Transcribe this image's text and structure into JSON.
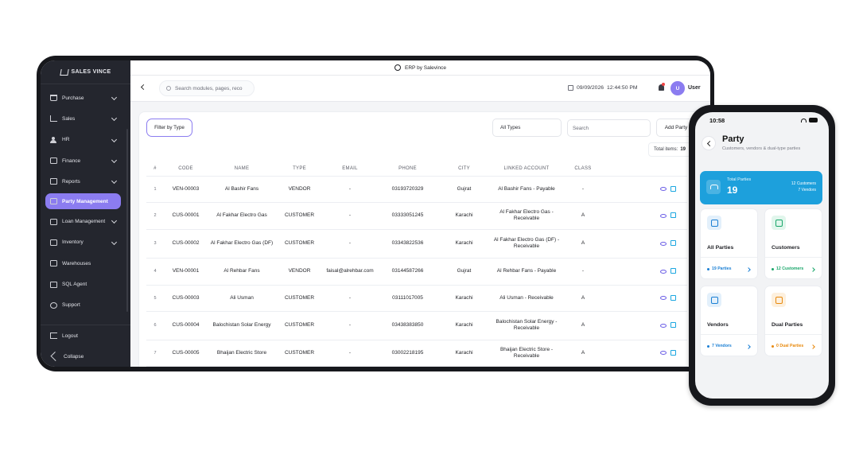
{
  "tablet": {
    "app_title": "ERP by Salevince",
    "brand": "SALES VINCE",
    "sidebar": {
      "items": [
        {
          "label": "Purchase",
          "icon": "cart-icon",
          "chevron": true
        },
        {
          "label": "Sales",
          "icon": "chart-icon",
          "chevron": true
        },
        {
          "label": "HR",
          "icon": "person-icon",
          "chevron": true
        },
        {
          "label": "Finance",
          "icon": "card-icon",
          "chevron": true
        },
        {
          "label": "Reports",
          "icon": "report-icon",
          "chevron": true
        },
        {
          "label": "Party Management",
          "icon": "handshake-icon",
          "chevron": false,
          "active": true
        },
        {
          "label": "Loan Management",
          "icon": "loan-icon",
          "chevron": true
        },
        {
          "label": "Inventory",
          "icon": "box-icon",
          "chevron": true
        },
        {
          "label": "Warehouses",
          "icon": "warehouse-icon",
          "chevron": false
        },
        {
          "label": "SQL Agent",
          "icon": "database-icon",
          "chevron": false
        },
        {
          "label": "Support",
          "icon": "support-icon",
          "chevron": false
        }
      ],
      "logout": "Logout",
      "collapse": "Collapse"
    },
    "topbar": {
      "search_placeholder": "Search modules, pages, reco",
      "date": "09/09/2026",
      "time": "12:44:50 PM",
      "avatar_initial": "U",
      "user": "User"
    },
    "toolbar": {
      "filter_label": "Filter by Type",
      "type_select": "All Types",
      "search_placeholder": "Search",
      "add_party": "Add Party",
      "total_items_label": "Total items:",
      "total_items_value": "19"
    },
    "table": {
      "headers": [
        "#",
        "CODE",
        "NAME",
        "TYPE",
        "EMAIL",
        "PHONE",
        "CITY",
        "LINKED ACCOUNT",
        "CLASS",
        ""
      ],
      "rows": [
        {
          "n": "1",
          "code": "VEN-00003",
          "name": "Al Bashir Fans",
          "type": "VENDOR",
          "email": "-",
          "phone": "03193720329",
          "city": "Gujrat",
          "account": "Al Bashir Fans - Payable",
          "class": "-"
        },
        {
          "n": "2",
          "code": "CUS-00001",
          "name": "Al Fakhar Electro Gas",
          "type": "CUSTOMER",
          "email": "-",
          "phone": "03333051245",
          "city": "Karachi",
          "account": "Al Fakhar Electro Gas - Receivable",
          "class": "A"
        },
        {
          "n": "3",
          "code": "CUS-00002",
          "name": "Al Fakhar Electro Gas (DF)",
          "type": "CUSTOMER",
          "email": "-",
          "phone": "03343822536",
          "city": "Karachi",
          "account": "Al Fakhar Electro Gas (DF) - Receivable",
          "class": "A"
        },
        {
          "n": "4",
          "code": "VEN-00001",
          "name": "Al Rehbar Fans",
          "type": "VENDOR",
          "email": "faisal@alrehbar.com",
          "phone": "03144587266",
          "city": "Gujrat",
          "account": "Al Rehbar Fans - Payable",
          "class": "-"
        },
        {
          "n": "5",
          "code": "CUS-00003",
          "name": "Ali Usman",
          "type": "CUSTOMER",
          "email": "-",
          "phone": "03111017005",
          "city": "Karachi",
          "account": "Ali Usman - Receivable",
          "class": "A"
        },
        {
          "n": "6",
          "code": "CUS-00004",
          "name": "Balochistan Solar Energy",
          "type": "CUSTOMER",
          "email": "-",
          "phone": "03438383850",
          "city": "Karachi",
          "account": "Balochistan Solar Energy - Receivable",
          "class": "A"
        },
        {
          "n": "7",
          "code": "CUS-00005",
          "name": "Bhaijan Electric Store",
          "type": "CUSTOMER",
          "email": "-",
          "phone": "03002218195",
          "city": "Karachi",
          "account": "Bhaijan Electric Store - Receivable",
          "class": "A"
        }
      ]
    }
  },
  "phone": {
    "status_time": "10:58",
    "title": "Party",
    "subtitle": "Customers, vendors & dual-type parties",
    "total": {
      "label": "Total Parties",
      "value": "19",
      "customers": "12 Customers",
      "vendors": "7 Vendors"
    },
    "cards": [
      {
        "title": "All Parties",
        "count": "19 Parties",
        "color": "#1a7fd4",
        "bg": "#e3f0fb",
        "icon": "people-icon"
      },
      {
        "title": "Customers",
        "count": "12 Customers",
        "color": "#19a66a",
        "bg": "#e1f6ec",
        "icon": "customers-icon"
      },
      {
        "title": "Vendors",
        "count": "7 Vendors",
        "color": "#1a7fd4",
        "bg": "#e3f0fb",
        "icon": "building-icon"
      },
      {
        "title": "Dual Parties",
        "count": "0 Dual Parties",
        "color": "#e8890c",
        "bg": "#fdf0de",
        "icon": "dual-icon"
      }
    ]
  }
}
